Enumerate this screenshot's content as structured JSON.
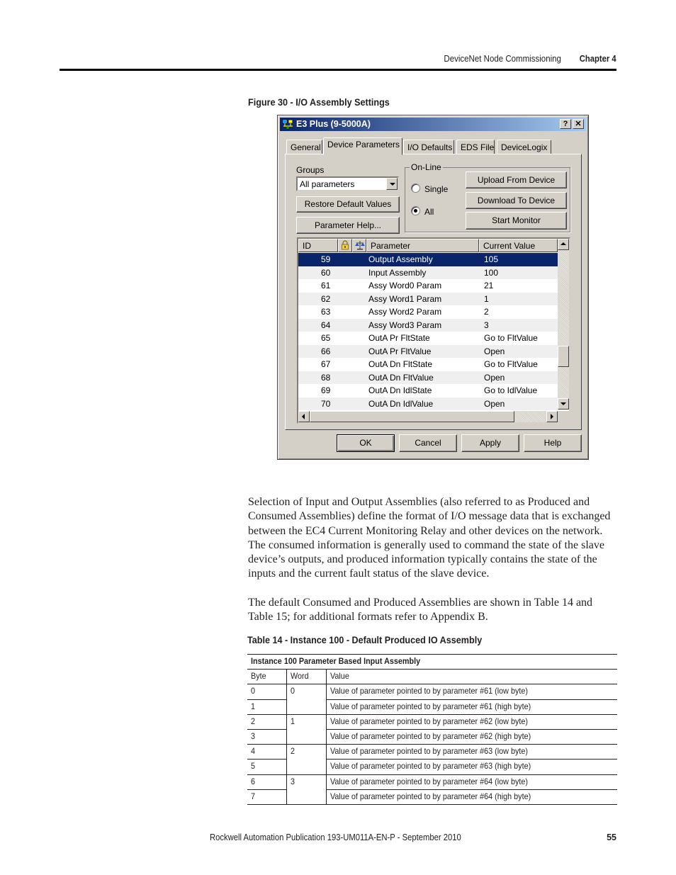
{
  "header": {
    "section": "DeviceNet Node Commissioning",
    "chapter": "Chapter 4"
  },
  "figure": {
    "caption": "Figure 30 - I/O Assembly Settings"
  },
  "dialog": {
    "title": "E3 Plus (9-5000A)",
    "title_icon": "network-device-icon",
    "help_button": "?",
    "close_button": "✕",
    "tabs": [
      {
        "label": "General",
        "active": false
      },
      {
        "label": "Device Parameters",
        "active": true
      },
      {
        "label": "I/O Defaults",
        "active": false
      },
      {
        "label": "EDS File",
        "active": false
      },
      {
        "label": "DeviceLogix",
        "active": false
      }
    ],
    "groups_label": "Groups",
    "groups_value": "All parameters",
    "restore_button": "Restore Default Values",
    "param_help_button": "Parameter Help...",
    "online_label": "On-Line",
    "radio_single": "Single",
    "radio_all": "All",
    "radio_selected": "All",
    "upload_button": "Upload From Device",
    "download_button": "Download To Device",
    "monitor_button": "Start Monitor",
    "list": {
      "columns": {
        "id": "ID",
        "lock_icon": "lock-icon",
        "monitor_icon": "scale-icon",
        "parameter": "Parameter",
        "value": "Current Value"
      },
      "rows": [
        {
          "id": "59",
          "parameter": "Output Assembly",
          "value": "105",
          "selected": true
        },
        {
          "id": "60",
          "parameter": "Input Assembly",
          "value": "100"
        },
        {
          "id": "61",
          "parameter": "Assy Word0 Param",
          "value": "21"
        },
        {
          "id": "62",
          "parameter": "Assy Word1 Param",
          "value": "1"
        },
        {
          "id": "63",
          "parameter": "Assy Word2 Param",
          "value": "2"
        },
        {
          "id": "64",
          "parameter": "Assy Word3 Param",
          "value": "3"
        },
        {
          "id": "65",
          "parameter": "OutA Pr FltState",
          "value": "Go to FltValue"
        },
        {
          "id": "66",
          "parameter": "OutA Pr FltValue",
          "value": "Open"
        },
        {
          "id": "67",
          "parameter": "OutA Dn FltState",
          "value": "Go to FltValue"
        },
        {
          "id": "68",
          "parameter": "OutA Dn FltValue",
          "value": "Open"
        },
        {
          "id": "69",
          "parameter": "OutA Dn IdlState",
          "value": "Go to IdlValue"
        },
        {
          "id": "70",
          "parameter": "OutA Dn IdlValue",
          "value": "Open"
        }
      ]
    },
    "ok_button": "OK",
    "cancel_button": "Cancel",
    "apply_button": "Apply",
    "help_bottom_button": "Help"
  },
  "body": {
    "paragraph1": "Selection of Input and Output Assemblies (also referred to as Produced and Consumed Assemblies) define the format of I/O message data that is exchanged between the EC4 Current Monitoring Relay and other devices on the network. The consumed information is generally used to command the state of the slave device’s outputs, and produced information typically contains the state of the inputs and the current fault status of the slave device.",
    "paragraph2": "The default Consumed and Produced Assemblies are shown in Table 14 and Table 15; for additional formats refer to Appendix B."
  },
  "table": {
    "caption": "Table 14 - Instance 100 - Default Produced IO Assembly",
    "title": "Instance 100 Parameter Based Input Assembly",
    "headers": [
      "Byte",
      "Word",
      "Value"
    ],
    "rows": [
      {
        "byte": "0",
        "word": "0",
        "value": "Value of parameter pointed to by parameter #61 (low byte)"
      },
      {
        "byte": "1",
        "word": "",
        "value": "Value of parameter pointed to by parameter #61 (high byte)"
      },
      {
        "byte": "2",
        "word": "1",
        "value": "Value of parameter pointed to by parameter #62 (low byte)"
      },
      {
        "byte": "3",
        "word": "",
        "value": "Value of parameter pointed to by parameter #62 (high byte)"
      },
      {
        "byte": "4",
        "word": "2",
        "value": "Value of parameter pointed to by parameter #63 (low byte)"
      },
      {
        "byte": "5",
        "word": "",
        "value": "Value of parameter pointed to by parameter #63 (high byte)"
      },
      {
        "byte": "6",
        "word": "3",
        "value": "Value of parameter pointed to by parameter #64 (low byte)"
      },
      {
        "byte": "7",
        "word": "",
        "value": "Value of parameter pointed to by parameter #64 (high byte)"
      }
    ]
  },
  "footer": {
    "publication": "Rockwell Automation Publication 193-UM011A-EN-P - September 2010",
    "page_number": "55"
  }
}
